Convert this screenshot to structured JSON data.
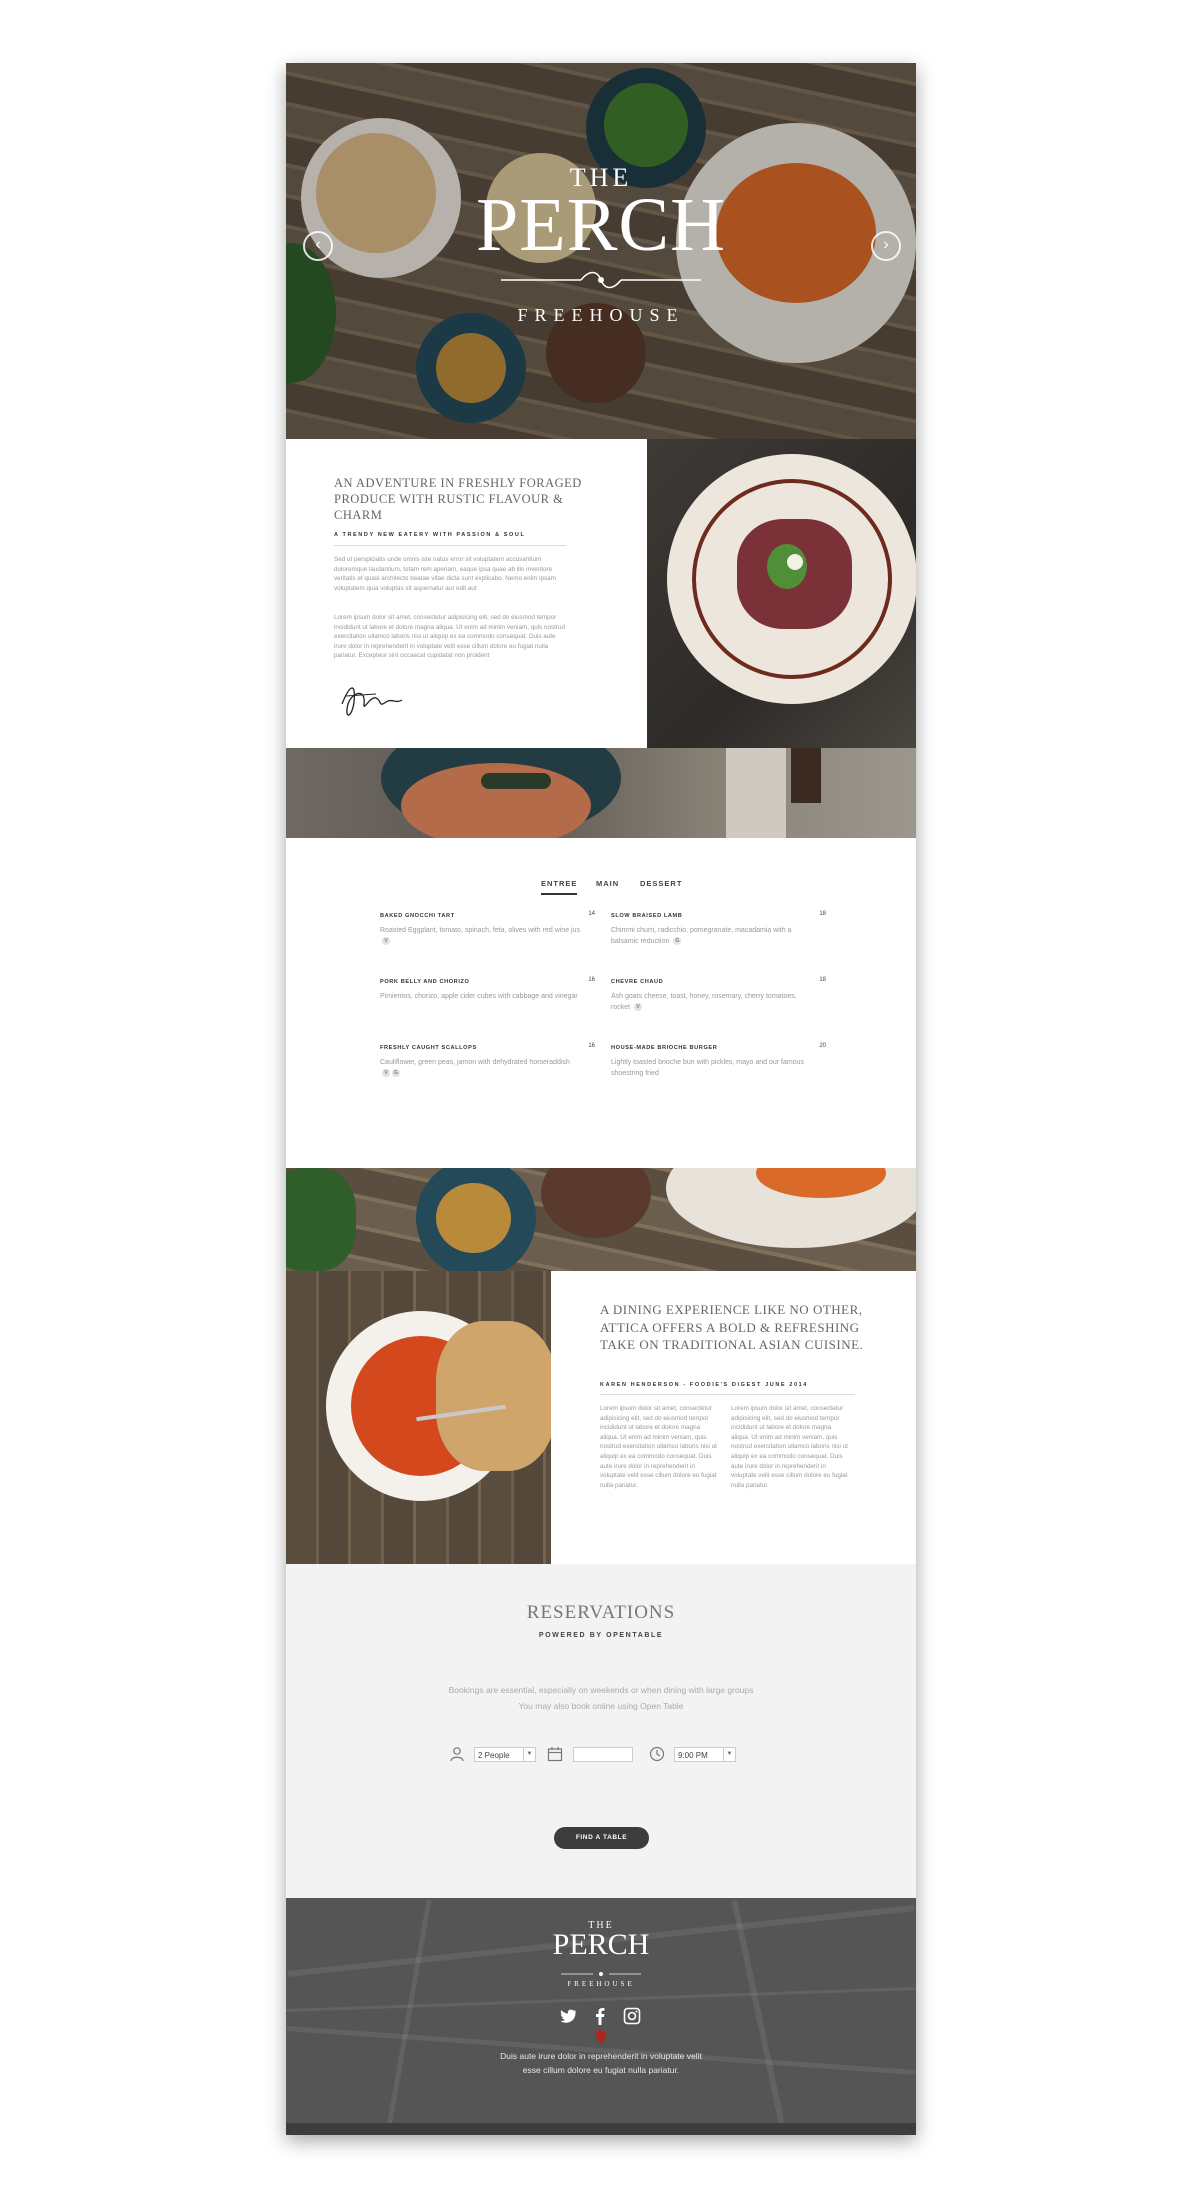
{
  "hero": {
    "logo_the": "THE",
    "logo_name": "PERCH",
    "logo_sub": "FREEHOUSE",
    "prev_icon": "chevron-left-icon",
    "next_icon": "chevron-right-icon"
  },
  "about": {
    "title": "AN ADVENTURE IN FRESHLY FORAGED PRODUCE WITH RUSTIC FLAVOUR & CHARM",
    "kicker": "A TRENDY NEW EATERY WITH PASSION & SOUL",
    "para1": "Sed ut perspiciatis unde omnis iste natus error sit voluptatem accusantium doloremque laudantium, totam rem aperiam, eaque ipsa quae ab illo inventore veritatis et quasi architecto beatae vitae dicta sunt explicabo. Nemo enim ipsam voluptatem quia voluptas sit aspernatur aut odit aut",
    "para2": "Lorem ipsum dolor sit amet, consectetur adipisicing elit, sed do eiusmod tempor incididunt ut labore et dolore magna aliqua. Ut enim ad minim veniam, quis nostrud exercitation ullamco laboris nisi ut aliquip ex ea commodo consequat. Duis aute irure dolor in reprehenderit in voluptate velit esse cillum dolore eu fugiat nulla pariatur. Excepteur sint occaecat cupidatat non proident"
  },
  "menu": {
    "tabs": [
      "ENTREE",
      "MAIN",
      "DESSERT"
    ],
    "active_tab": "ENTREE",
    "left": [
      {
        "name": "BAKED GNOCCHI TART",
        "price": "14",
        "desc": "Roasted Eggplant, tomato, spinach, feta, olives with red wine jus",
        "badges": [
          "V"
        ]
      },
      {
        "name": "PORK BELLY AND CHORIZO",
        "price": "16",
        "desc": "Pimientos, chorizo, apple cider cubes with cabbage and vinegar",
        "badges": []
      },
      {
        "name": "FRESHLY CAUGHT SCALLOPS",
        "price": "16",
        "desc": "Cauliflower, green peas, jamon with dehydrated horseraddish",
        "badges": [
          "V",
          "G"
        ]
      }
    ],
    "right": [
      {
        "name": "SLOW BRAISED LAMB",
        "price": "18",
        "desc": "Chimmi churri, radicchio, pomegranate, macadamia with a balsamic reduction",
        "badges": [
          "G"
        ]
      },
      {
        "name": "CHEVRE CHAUD",
        "price": "18",
        "desc": "Ash goats cheese, toast, honey, rosemary, cherry tomatoes, rocket",
        "badges": [
          "V"
        ]
      },
      {
        "name": "HOUSE-MADE BRIOCHE BURGER",
        "price": "20",
        "desc": "Lightly toasted brioche bun with pickles, mayo and our famous shoestring fried",
        "badges": []
      }
    ]
  },
  "experience": {
    "title": "A DINING EXPERIENCE LIKE NO OTHER, ATTICA OFFERS A BOLD & REFRESHING TAKE ON TRADITIONAL ASIAN CUISINE.",
    "kicker": "KAREN HENDERSON - FOODIE'S DIGEST JUNE 2014",
    "col1": "Lorem ipsum dolor sit amet, consectetur adipisicing elit, sed do eiusmod tempor incididunt ut labore et dolore magna aliqua. Ut enim ad minim veniam, quis nostrud exercitation ullamco laboris nisi ut aliquip ex ea commodo consequat. Duis aute irure dolor in reprehenderit in voluptate velit esse cillum dolore eu fugiat nulla pariatur.",
    "col2": "Lorem ipsum dolor sit amet, consectetur adipisicing elit, sed do eiusmod tempor incididunt ut labore et dolore magna aliqua. Ut enim ad minim veniam, quis nostrud exercitation ullamco laboris nisi ut aliquip ex ea commodo consequat. Duis aute irure dolor in reprehenderit in voluptate velit esse cillum dolore eu fugiat nulla pariatur."
  },
  "reservations": {
    "title": "RESERVATIONS",
    "subtitle": "POWERED BY OPENTABLE",
    "line1": "Bookings are essential, especially on weekends or when dining with large groups",
    "line2": "You may also book online using Open Table",
    "people_value": "2 People",
    "date_value": "",
    "time_value": "9:00 PM",
    "button": "FIND A TABLE",
    "icons": [
      "person-icon",
      "calendar-icon",
      "clock-icon"
    ]
  },
  "footer": {
    "logo_the": "THE",
    "logo_name": "PERCH",
    "logo_sub": "FREEHOUSE",
    "social": [
      "twitter-icon",
      "facebook-icon",
      "instagram-icon"
    ],
    "line1": "Duis aute irure dolor in reprehenderit in voluptate velit",
    "line2": "esse cillum dolore eu fugiat nulla pariatur."
  },
  "colors": {
    "text_dark": "#333333",
    "text_muted": "#999999",
    "reservations_bg": "#f3f3f3",
    "footer_bg": "#555555",
    "button_bg": "#3c3c3c"
  }
}
